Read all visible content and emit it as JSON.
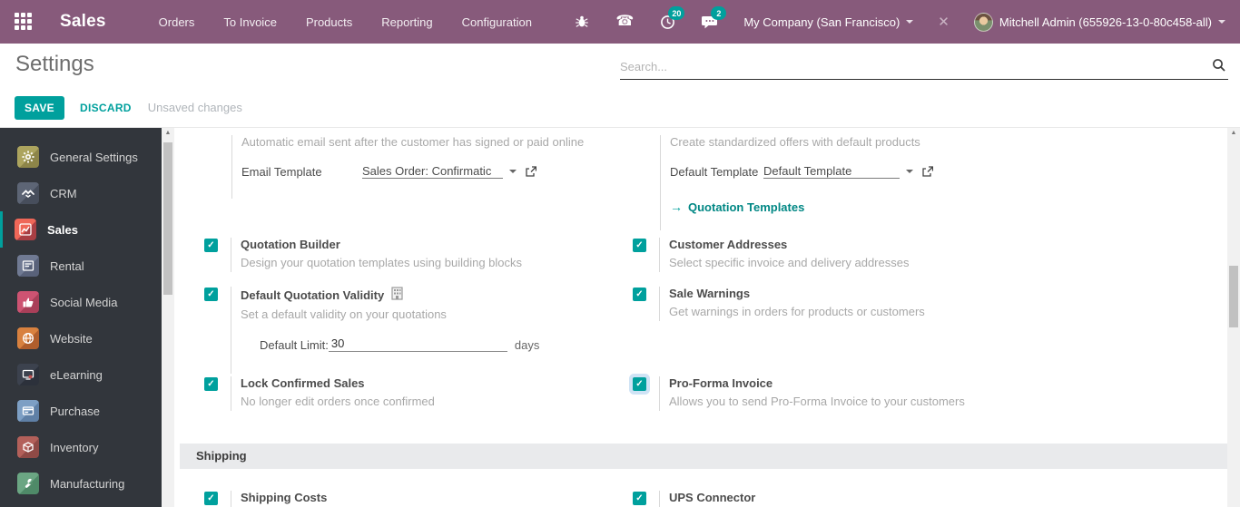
{
  "colors": {
    "navbar": "#875A7B",
    "accent": "#00A09D",
    "checkbox": "#00A09D",
    "link": "#008784",
    "highlight": "#cfe3f5"
  },
  "navbar": {
    "brand": "Sales",
    "menu": [
      {
        "label": "Orders"
      },
      {
        "label": "To Invoice"
      },
      {
        "label": "Products"
      },
      {
        "label": "Reporting"
      },
      {
        "label": "Configuration"
      }
    ],
    "activity_count": "20",
    "message_count": "2",
    "company": "My Company (San Francisco)",
    "user": "Mitchell Admin (655926-13-0-80c458-all)"
  },
  "control_panel": {
    "title": "Settings",
    "search_placeholder": "Search...",
    "save_label": "SAVE",
    "discard_label": "DISCARD",
    "unsaved_label": "Unsaved changes"
  },
  "sidebar": {
    "items": [
      {
        "label": "General Settings",
        "icon": "gear"
      },
      {
        "label": "CRM",
        "icon": "handshake"
      },
      {
        "label": "Sales",
        "icon": "line-chart",
        "active": true
      },
      {
        "label": "Rental",
        "icon": "kanban-card"
      },
      {
        "label": "Social Media",
        "icon": "thumbs-up"
      },
      {
        "label": "Website",
        "icon": "globe"
      },
      {
        "label": "eLearning",
        "icon": "screen"
      },
      {
        "label": "Purchase",
        "icon": "credit-card"
      },
      {
        "label": "Inventory",
        "icon": "box"
      },
      {
        "label": "Manufacturing",
        "icon": "wrench"
      }
    ]
  },
  "main": {
    "top_left": {
      "desc": "Automatic email sent after the customer has signed or paid online",
      "label": "Email Template",
      "value": "Sales Order: Confirmatic"
    },
    "top_right": {
      "desc": "Create standardized offers with default products",
      "label": "Default Template",
      "value": "Default Template",
      "link": "Quotation Templates"
    },
    "left_rows": [
      {
        "title": "Quotation Builder",
        "desc": "Design your quotation templates using building blocks",
        "checked": true
      },
      {
        "title": "Default Quotation Validity",
        "desc": "Set a default validity on your quotations",
        "checked": true
      },
      {
        "title": "Lock Confirmed Sales",
        "desc": "No longer edit orders once confirmed",
        "checked": true
      }
    ],
    "right_rows": [
      {
        "title": "Customer Addresses",
        "desc": "Select specific invoice and delivery addresses",
        "checked": true
      },
      {
        "title": "Sale Warnings",
        "desc": "Get warnings in orders for products or customers",
        "checked": true
      },
      {
        "title": "Pro-Forma Invoice",
        "desc": "Allows you to send Pro-Forma Invoice to your customers",
        "checked": true,
        "highlighted": true
      }
    ],
    "validity_sub": {
      "label": "Default Limit:",
      "value": "30",
      "suffix": "days"
    },
    "shipping": {
      "header": "Shipping",
      "left_title": "Shipping Costs",
      "right_title": "UPS Connector",
      "left_checked": true,
      "right_checked": true
    }
  }
}
